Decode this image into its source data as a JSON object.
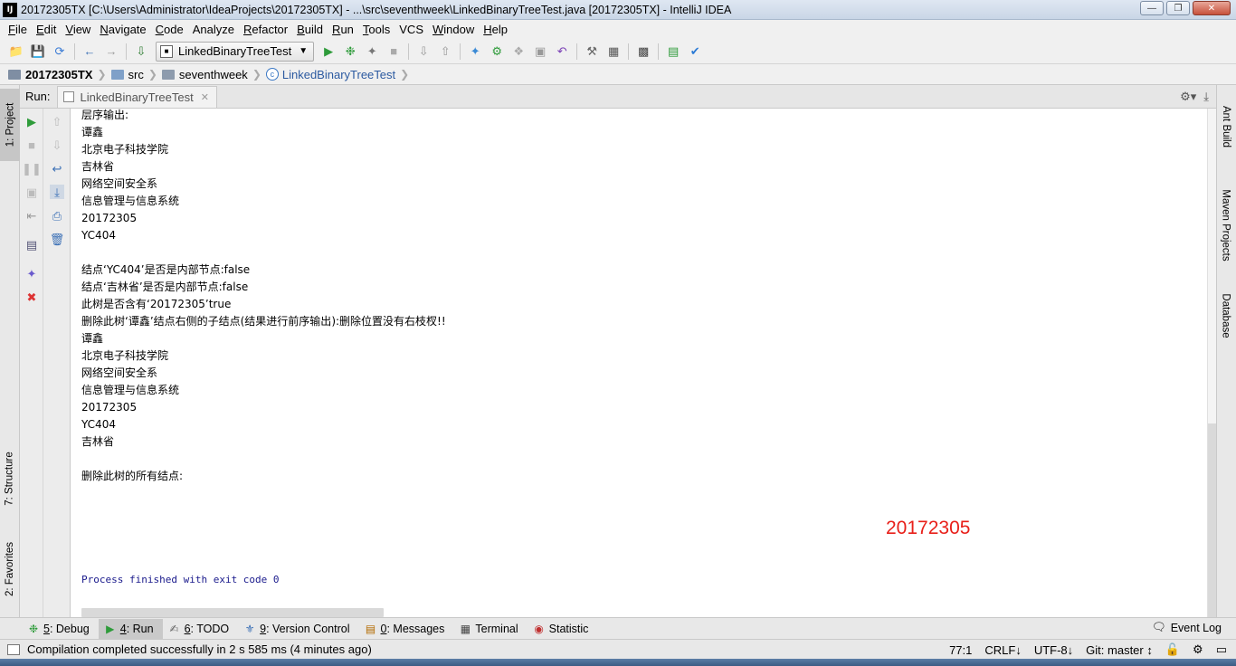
{
  "window": {
    "title": "20172305TX [C:\\Users\\Administrator\\IdeaProjects\\20172305TX] - ...\\src\\seventhweek\\LinkedBinaryTreeTest.java [20172305TX] - IntelliJ IDEA",
    "logo": "IJ"
  },
  "menu": {
    "items": [
      {
        "u": "F",
        "rest": "ile"
      },
      {
        "u": "E",
        "rest": "dit"
      },
      {
        "u": "V",
        "rest": "iew"
      },
      {
        "u": "N",
        "rest": "avigate"
      },
      {
        "u": "C",
        "rest": "ode"
      },
      {
        "u": "",
        "rest": "Analyze"
      },
      {
        "u": "R",
        "rest": "efactor"
      },
      {
        "u": "B",
        "rest": "uild"
      },
      {
        "u": "R",
        "rest": "un"
      },
      {
        "u": "T",
        "rest": "ools"
      },
      {
        "u": "",
        "rest": "VCS"
      },
      {
        "u": "W",
        "rest": "indow"
      },
      {
        "u": "H",
        "rest": "elp"
      }
    ]
  },
  "toolbar": {
    "run_config": "LinkedBinaryTreeTest"
  },
  "breadcrumb": {
    "root": "20172305TX",
    "src": "src",
    "pkg": "seventhweek",
    "file": "LinkedBinaryTreeTest"
  },
  "left_stripe": {
    "project": "1: Project",
    "structure": "7: Structure",
    "favorites": "2: Favorites"
  },
  "right_stripe": {
    "ant": "Ant Build",
    "maven": "Maven Projects",
    "database": "Database"
  },
  "run_panel": {
    "label": "Run:",
    "tab": "LinkedBinaryTreeTest"
  },
  "console": {
    "lines": [
      "层序输出:",
      "谭鑫",
      "北京电子科技学院",
      "吉林省",
      "网络空间安全系",
      "信息管理与信息系统",
      "20172305",
      "YC404",
      "",
      "结点‘YC404’是否是内部节点:false",
      "结点‘吉林省’是否是内部节点:false",
      "此树是否含有‘20172305’true",
      "删除此树‘谭鑫’结点右侧的子结点(结果进行前序输出):删除位置没有右枝杈!!",
      "谭鑫",
      "北京电子科技学院",
      "网络空间安全系",
      "信息管理与信息系统",
      "20172305",
      "YC404",
      "吉林省",
      "",
      "删除此树的所有结点:"
    ],
    "exit_line": "Process finished with exit code 0",
    "watermark": "20172305"
  },
  "bottom_tabs": [
    {
      "num": "5",
      "label": ": Debug",
      "icon": "debug-icon"
    },
    {
      "num": "4",
      "label": ": Run",
      "icon": "run-icon"
    },
    {
      "num": "6",
      "label": ": TODO",
      "icon": "todo-icon"
    },
    {
      "num": "9",
      "label": ": Version Control",
      "icon": "vcs-icon"
    },
    {
      "num": "0",
      "label": ": Messages",
      "icon": "messages-icon"
    },
    {
      "num": "",
      "label": "Terminal",
      "icon": "terminal-icon"
    },
    {
      "num": "",
      "label": "Statistic",
      "icon": "statistic-icon"
    }
  ],
  "event_log": "Event Log",
  "status": {
    "message": "Compilation completed successfully in 2 s 585 ms (4 minutes ago)",
    "position": "77:1",
    "line_sep": "CRLF↓",
    "encoding": "UTF-8↓",
    "git": "Git: master ↕"
  }
}
